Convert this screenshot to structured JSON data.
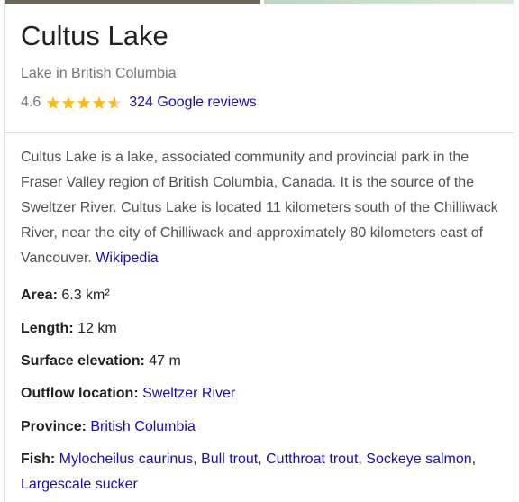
{
  "panel": {
    "title": "Cultus Lake",
    "subtitle": "Lake in British Columbia",
    "rating": {
      "value_text": "4.6",
      "stars": 4.6,
      "reviews_text": "324 Google reviews"
    },
    "description": {
      "text": "Cultus Lake is a lake, associated community and provincial park in the Fraser Valley region of British Columbia, Canada. It is the source of the Sweltzer River. Cultus Lake is located 11 kilometers south of the Chilliwack River, near the city of Chilliwack and approximately 80 kilometers east of Vancouver.",
      "source_link": "Wikipedia"
    },
    "facts": {
      "area": {
        "label": "Area:",
        "value": "6.3 km²"
      },
      "length": {
        "label": "Length:",
        "value": "12 km"
      },
      "elevation": {
        "label": "Surface elevation:",
        "value": "47 m"
      },
      "outflow": {
        "label": "Outflow location:",
        "value": "Sweltzer River"
      },
      "province": {
        "label": "Province:",
        "value": "British Columbia"
      },
      "fish": {
        "label": "Fish:",
        "items": [
          "Mylocheilus caurinus",
          "Bull trout",
          "Cutthroat trout",
          "Sockeye salmon",
          "Largescale sucker"
        ]
      }
    }
  },
  "colors": {
    "link": "#1a0dab",
    "star": "#fbbc04",
    "secondary_text": "#70757a"
  },
  "icons": {
    "star": "star-icon"
  }
}
